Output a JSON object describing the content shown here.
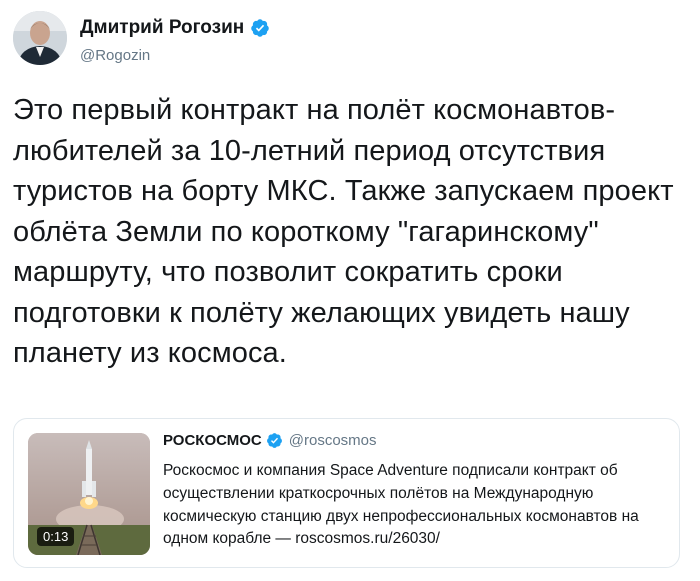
{
  "tweet": {
    "author": {
      "display_name": "Дмитрий Рогозин",
      "handle": "@Rogozin",
      "verified": true,
      "avatar_icon": "person-avatar-icon"
    },
    "text": "Это первый контракт на полёт космонавтов-любителей за 10-летний период отсутствия туристов на борту МКС. Также запускаем проект облёта Земли по короткому \"гагаринскому\" маршруту, что позволит сократить сроки подготовки к полёту желающих увидеть нашу планету из космоса."
  },
  "quoted_tweet": {
    "author": {
      "display_name": "РОСКОСМОС",
      "handle": "@roscosmos",
      "verified": true
    },
    "media": {
      "type": "video",
      "duration": "0:13",
      "thumbnail_icon": "rocket-launch-thumbnail"
    },
    "text": "Роскосмос и компания Space Adventure подписали контракт об осуществлении краткосрочных полётов на Международную космическую станцию двух непрофессиональных космонавтов на одном корабле — roscosmos.ru/26030/"
  },
  "colors": {
    "verified_blue": "#1da1f2",
    "secondary_text": "#657786",
    "border": "#e1e8ed",
    "primary_text": "#14171a"
  }
}
